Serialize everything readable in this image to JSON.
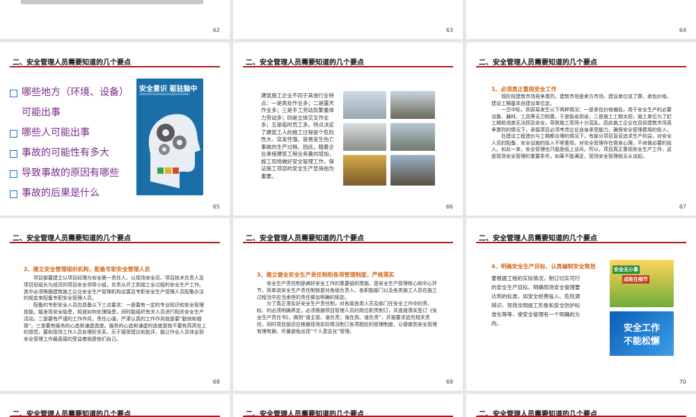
{
  "header_title": "二、安全管理人员需要知道的几个要点",
  "page_numbers": [
    "62",
    "63",
    "64",
    "65",
    "66",
    "67",
    "68",
    "69",
    "70"
  ],
  "slide65": {
    "bullets": [
      "哪些地方（环境、设备）可能出事",
      "哪些人可能出事",
      "事故的可能性有多大",
      "导致事故的原因有哪些",
      "事故的后果是什么"
    ],
    "poster_title": "安全意识 驱驻脑中",
    "poster_sub": "ANQUANYISHIYONGZHUNAOZHONG"
  },
  "slide66": {
    "text": "建筑施工企业不同于其他行业特点：一是高处作业多；二是露天作业多；三是手工劳动及繁重体力劳动多；四是立体交叉作业多；五是临时员工多。特点决定了建筑工人的施工过程是个危险性大、突发性强、容易发生伤亡事故的生产过程。因此，随着企业承接建筑工程业务量的增加，施工现场做好安全管理工作，保证施工项目的安全生产显得由为重要。"
  },
  "slide67": {
    "title": "1、必须真正重视安全工作",
    "p1": "现阶段建筑市场竞争激烈，建筑市场是卖方市场，建设单位说了算，承包价格、建设工期基本由建设单位定。",
    "p2": "一旦中标，则容易发生以下两种情况：一是承包价格偏低，用于安全生产的必要设备、器材、工具等无力购置，于是能省则省；二是施工工期太短，施工单位为了赶工期抢进度无法顾及安全，导致施工现场十分混乱。因此施工企业在目前建筑市场竞争激烈的情况下，承接项目必须考虑企业自身承受能力，确保安全管理费用的投入。",
    "p3": "在建设工程造价与工期都合理的情况下，有部分项目盲目追求生产利益，对安全人员的配备、安全设施的投入不够重视，对安全管理存在侥幸心理，不肯做必要的投入。如此一来，安全管理也只能是纸上谈兵。所以，项目真正重视安全生产工作，这是现场安全管理的重要条件，如果不能满足，现场安全管理就无从谈起。"
  },
  "slide68": {
    "title": "2、建立安全管理组织机构，配备专职安全管理人员",
    "p1": "项目部要建立以项目经理为安全第一责任人、以现场安全员、项目技术负责人及项目班组长为成员的项目安全领导小组，负责从开工到竣工全过程的安全生产工作。其中必须根据建筑施工企业安全生产管理机构设置及专职安全生产管理人员配备办法的规定来配备专职安全管理人员。",
    "p2": "配备的专职安全人员应具备以下三点要求：一是要有一定的专业知识和安全管理技能，能发现安全隐患，知道如何处理隐患，同时能组织有关人员进行相关安全生产活动。二是要有严谨的工作作风，责任心强，严肃认真的工作作风就是要“勤快和细致”。三是要有服务的心态和谦虚态度。服务的心态和谦虚的态度是指不要有高高在上的感觉，要和现场工作人员处理好关系，乐于接受建议和批评，能让作业人员体会到安全管理工作最直接的受益者就是他们自己。"
  },
  "slide69": {
    "title": "3、建立健全安全生产责任制和各项管理制度，严格落实",
    "p1": "安全生产责任制是搞好安全工作的重要组织措施，是安全生产管理核心和中心环节。简单说安全生产责任制就是对各级负责人、各职能部门以及各类施工人员在施工过程当中应当承担的责任做出明确的规定。",
    "p2": "为了真正落实好安全生产责任制，对各级各类人员及部门在安全工作中的责、权、利必须明确界定，必须根据项目管理人员的岗位职责制订，并逐层落实签订《安全生产责任书》，做到“谁主管、谁负责；谁在岗、谁负责”，并按要求追究相关责任。同时项目部还应根据现场实际情况制订各项相应的管理制度，以便做到安全管理有理有据，尽量避免出现“个人意志化”管理。"
  },
  "slide70": {
    "title": "4、明确安全生产目标，认真编制安全策划",
    "text": "要根据工程的实际情况，制订切实可行的安全生产目标，明确现场安全管理要达到的标准，如安全经费投入、危险源辨识、现场文明施工形象和安全防护标准化等等，使安全管理有一个明确的方向。",
    "img1_text": [
      "安全无小事",
      "成败在细节"
    ],
    "img2_text": [
      "安全工作",
      "不能松懈"
    ]
  }
}
